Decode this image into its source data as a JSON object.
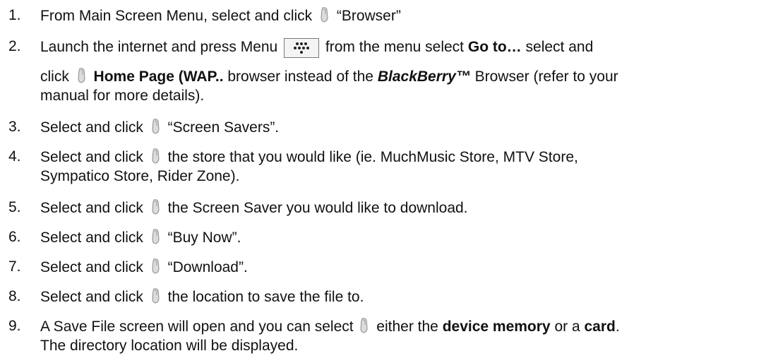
{
  "icons": {
    "trackwheel": "trackwheel-icon",
    "menu_key": "blackberry-menu-key-icon"
  },
  "steps": [
    {
      "num": "1.",
      "a": "From Main Screen Menu, select and click",
      "b": "“Browser”"
    },
    {
      "num": "2.",
      "l1a": "Launch the internet and press Menu",
      "l1b": "from the menu select",
      "l1c": "Go to…",
      "l1d": "select and",
      "l2a": "click",
      "l2b": "Home Page (WAP..",
      "l2c": "browser instead of the",
      "l2d": "BlackBerry™",
      "l2e": "Browser (refer to your",
      "l3": "manual for more details)."
    },
    {
      "num": "3.",
      "a": "Select and click",
      "b": "“Screen Savers”."
    },
    {
      "num": "4.",
      "a": "Select and click",
      "b": "the store that you would like (ie. MuchMusic Store, MTV Store,",
      "l2": "Sympatico Store, Rider Zone)."
    },
    {
      "num": "5.",
      "a": "Select and click",
      "b": "the Screen Saver you would like to download."
    },
    {
      "num": "6.",
      "a": "Select and click",
      "b": "“Buy Now”."
    },
    {
      "num": "7.",
      "a": "Select and click",
      "b": "“Download”."
    },
    {
      "num": "8.",
      "a": "Select and click",
      "b": "the location to save the file to."
    },
    {
      "num": "9.",
      "a": "A Save File screen will open and you can select",
      "b": "either the",
      "c": "device memory",
      "d": "or a",
      "e": "card",
      "f": ".",
      "l2": "The directory location will be displayed."
    }
  ]
}
